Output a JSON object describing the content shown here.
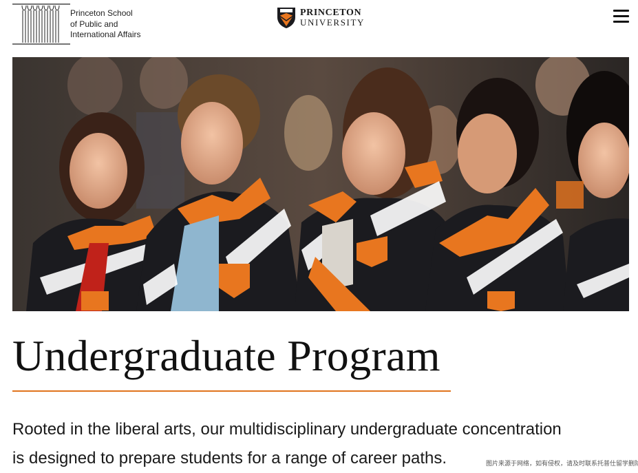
{
  "header": {
    "school_logo": {
      "line1": "Princeton School",
      "line2": "of Public and",
      "line3": "International Affairs"
    },
    "university_logo": {
      "top": "PRINCETON",
      "bottom": "UNIVERSITY"
    },
    "menu_icon": "hamburger-menu-icon"
  },
  "hero": {
    "description_icon": "photo-students-in-orange-black-jackets"
  },
  "main": {
    "title": "Undergraduate Program",
    "intro_line1": "Rooted in the liberal arts, our multidisciplinary undergraduate concentration",
    "intro_line2": "is designed to prepare students for a range of career paths."
  },
  "watermark": "图片来源于网络，如有侵权，请及时联系托普仕留学删除",
  "colors": {
    "accent_orange": "#e0731c",
    "jacket_black": "#1b1b1f",
    "text_dark": "#111111"
  }
}
